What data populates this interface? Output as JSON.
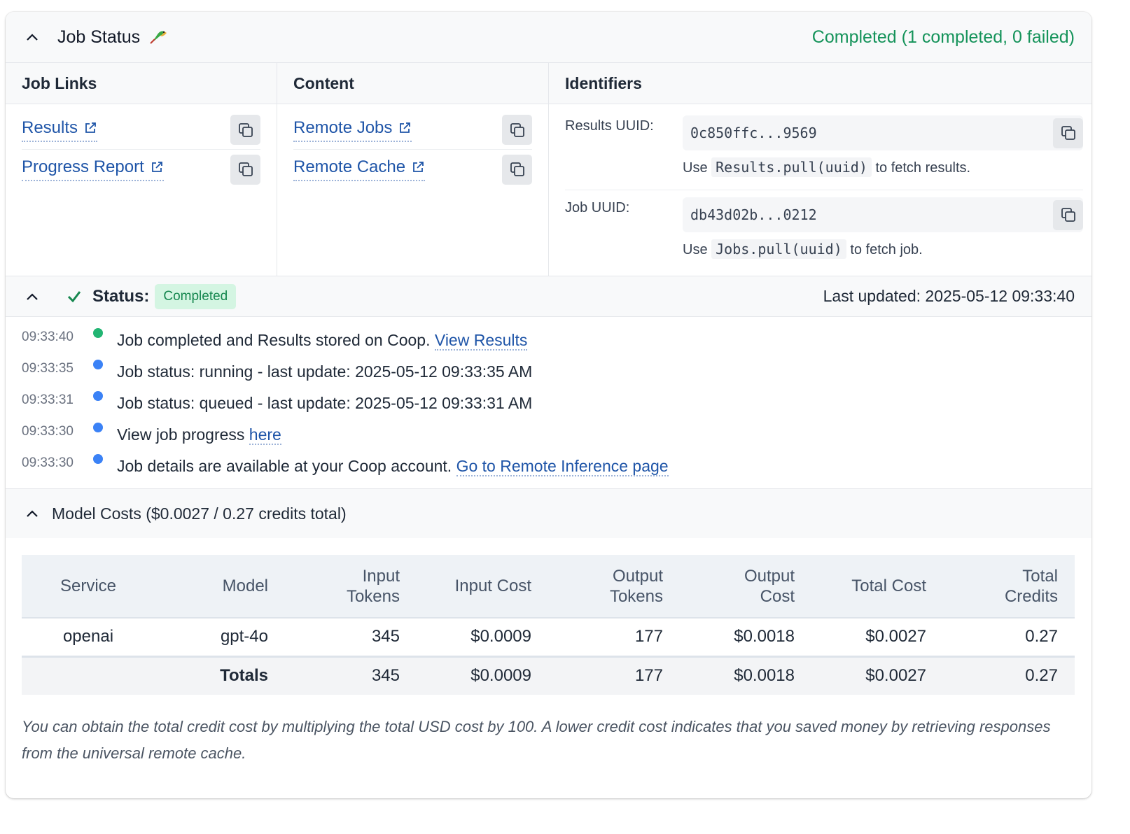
{
  "header": {
    "title": "Job Status",
    "status": "Completed (1 completed, 0 failed)"
  },
  "links": {
    "title": "Job Links",
    "items": [
      {
        "label": "Results"
      },
      {
        "label": "Progress Report"
      }
    ]
  },
  "content": {
    "title": "Content",
    "items": [
      {
        "label": "Remote Jobs"
      },
      {
        "label": "Remote Cache"
      }
    ]
  },
  "identifiers": {
    "title": "Identifiers",
    "results": {
      "label": "Results UUID:",
      "value": "0c850ffc...9569",
      "hint_pre": "Use",
      "hint_code": "Results.pull(uuid)",
      "hint_post": "to fetch results."
    },
    "job": {
      "label": "Job UUID:",
      "value": "db43d02b...0212",
      "hint_pre": "Use",
      "hint_code": "Jobs.pull(uuid)",
      "hint_post": "to fetch job."
    }
  },
  "status": {
    "label": "Status:",
    "badge": "Completed",
    "last_updated": "Last updated: 2025-05-12 09:33:40"
  },
  "log": [
    {
      "time": "09:33:40",
      "color": "#22b573",
      "text": "Job completed and Results stored on Coop.",
      "link": "View Results"
    },
    {
      "time": "09:33:35",
      "color": "#3b82f6",
      "text": "Job status: running - last update: 2025-05-12 09:33:35 AM",
      "link": ""
    },
    {
      "time": "09:33:31",
      "color": "#3b82f6",
      "text": "Job status: queued - last update: 2025-05-12 09:33:31 AM",
      "link": ""
    },
    {
      "time": "09:33:30",
      "color": "#3b82f6",
      "text": "View job progress",
      "link": "here"
    },
    {
      "time": "09:33:30",
      "color": "#3b82f6",
      "text": "Job details are available at your Coop account.",
      "link": "Go to Remote Inference page"
    }
  ],
  "costs": {
    "title": "Model Costs ($0.0027 / 0.27 credits total)",
    "columns": [
      "Service",
      "Model",
      "Input Tokens",
      "Input Cost",
      "Output Tokens",
      "Output Cost",
      "Total Cost",
      "Total Credits"
    ],
    "rows": [
      [
        "openai",
        "gpt-4o",
        "345",
        "$0.0009",
        "177",
        "$0.0018",
        "$0.0027",
        "0.27"
      ]
    ],
    "totals": [
      "",
      "Totals",
      "345",
      "$0.0009",
      "177",
      "$0.0018",
      "$0.0027",
      "0.27"
    ],
    "note": "You can obtain the total credit cost by multiplying the total USD cost by 100. A lower credit cost indicates that you saved money by retrieving responses from the universal remote cache."
  },
  "colors": {
    "accent_green": "#15935a",
    "link_blue": "#1f55a8"
  }
}
